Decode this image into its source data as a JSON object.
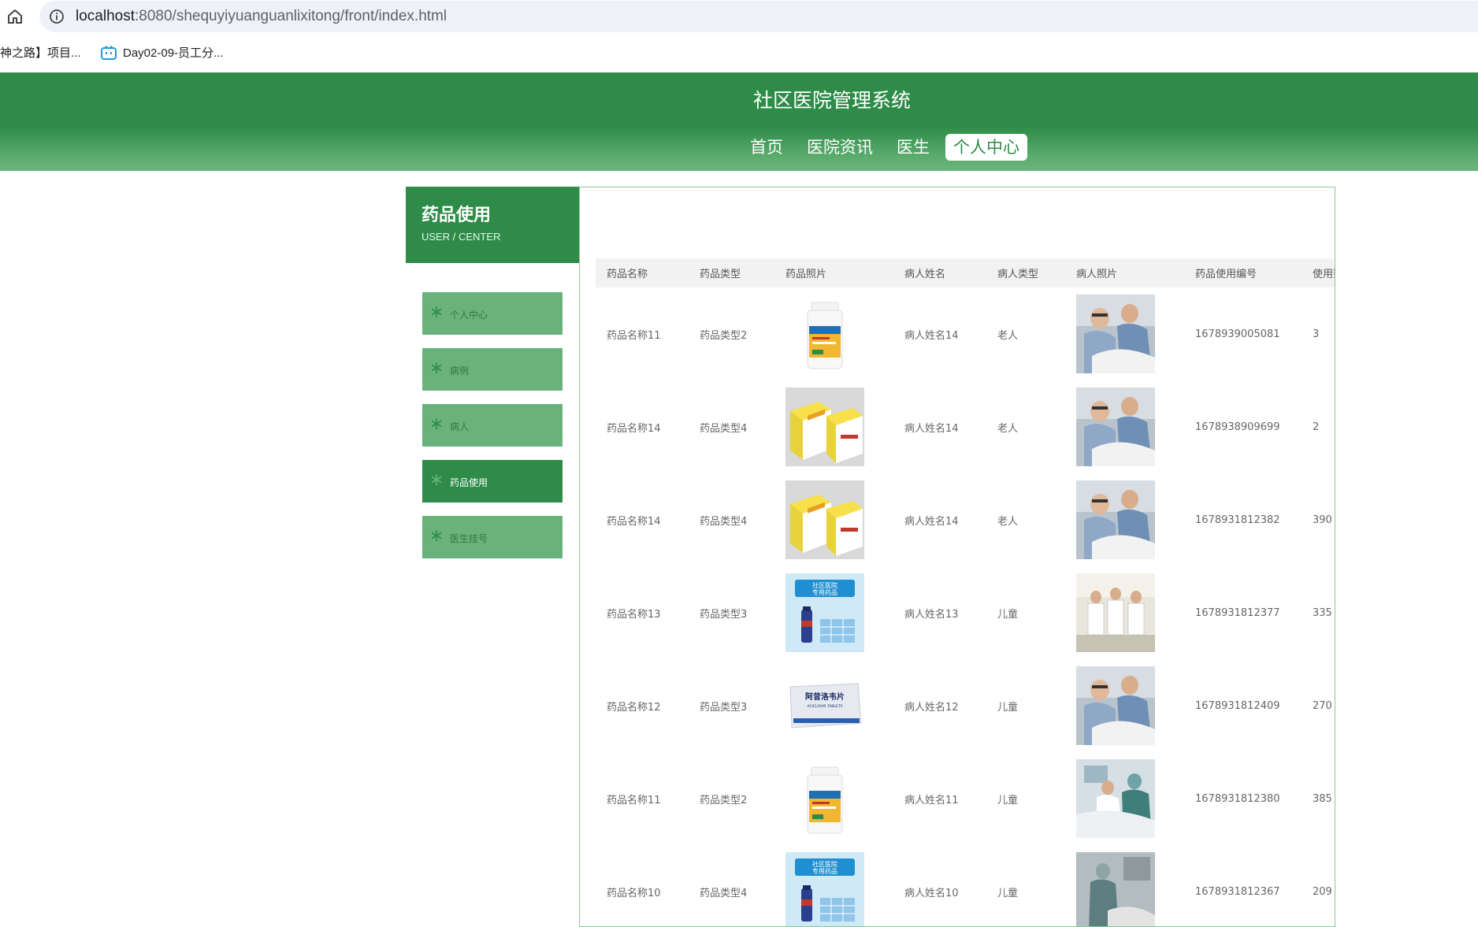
{
  "browser": {
    "url_host": "localhost",
    "url_path": ":8080/shequyiyuanguanlixitong/front/index.html",
    "bookmarks": [
      "神之路】项目...",
      "Day02-09-员工分..."
    ]
  },
  "header": {
    "title": "社区医院管理系统",
    "nav": [
      {
        "label": "首页",
        "active": false
      },
      {
        "label": "医院资讯",
        "active": false
      },
      {
        "label": "医生",
        "active": false
      },
      {
        "label": "个人中心",
        "active": true
      }
    ]
  },
  "sidebar": {
    "title": "药品使用",
    "subtitle": "USER / CENTER",
    "items": [
      {
        "label": "个人中心",
        "active": false
      },
      {
        "label": "病例",
        "active": false
      },
      {
        "label": "病人",
        "active": false
      },
      {
        "label": "药品使用",
        "active": true
      },
      {
        "label": "医生挂号",
        "active": false
      }
    ]
  },
  "table": {
    "columns": [
      "药品名称",
      "药品类型",
      "药品照片",
      "病人姓名",
      "病人类型",
      "病人照片",
      "药品使用编号",
      "使用数量"
    ],
    "rows": [
      {
        "name": "药品名称11",
        "type": "药品类型2",
        "drug_img": "bottle",
        "patient": "病人姓名14",
        "ptype": "老人",
        "patient_img": "ward-a",
        "code": "1678939005081",
        "qty": "3"
      },
      {
        "name": "药品名称14",
        "type": "药品类型4",
        "drug_img": "yellow-boxes",
        "patient": "病人姓名14",
        "ptype": "老人",
        "patient_img": "ward-a",
        "code": "1678938909699",
        "qty": "2"
      },
      {
        "name": "药品名称14",
        "type": "药品类型4",
        "drug_img": "yellow-boxes",
        "patient": "病人姓名14",
        "ptype": "老人",
        "patient_img": "ward-a",
        "code": "1678931812382",
        "qty": "390"
      },
      {
        "name": "药品名称13",
        "type": "药品类型3",
        "drug_img": "blue-poster",
        "patient": "病人姓名13",
        "ptype": "儿童",
        "patient_img": "ward-b",
        "code": "1678931812377",
        "qty": "335"
      },
      {
        "name": "药品名称12",
        "type": "药品类型3",
        "drug_img": "tablet-box",
        "patient": "病人姓名12",
        "ptype": "儿童",
        "patient_img": "ward-a",
        "code": "1678931812409",
        "qty": "270"
      },
      {
        "name": "药品名称11",
        "type": "药品类型2",
        "drug_img": "bottle",
        "patient": "病人姓名11",
        "ptype": "儿童",
        "patient_img": "ward-c",
        "code": "1678931812380",
        "qty": "385"
      },
      {
        "name": "药品名称10",
        "type": "药品类型4",
        "drug_img": "blue-poster",
        "patient": "病人姓名10",
        "ptype": "儿童",
        "patient_img": "ward-d",
        "code": "1678931812367",
        "qty": "209"
      }
    ]
  },
  "images": {
    "tablet_box_text": "阿昔洛韦片",
    "tablet_box_sub": "ACICLOVIR TABLETS",
    "poster_text_1": "社区医院",
    "poster_text_2": "专用药品"
  },
  "colors": {
    "brand_green": "#2e8c48",
    "menu_green": "#6ab27b"
  }
}
